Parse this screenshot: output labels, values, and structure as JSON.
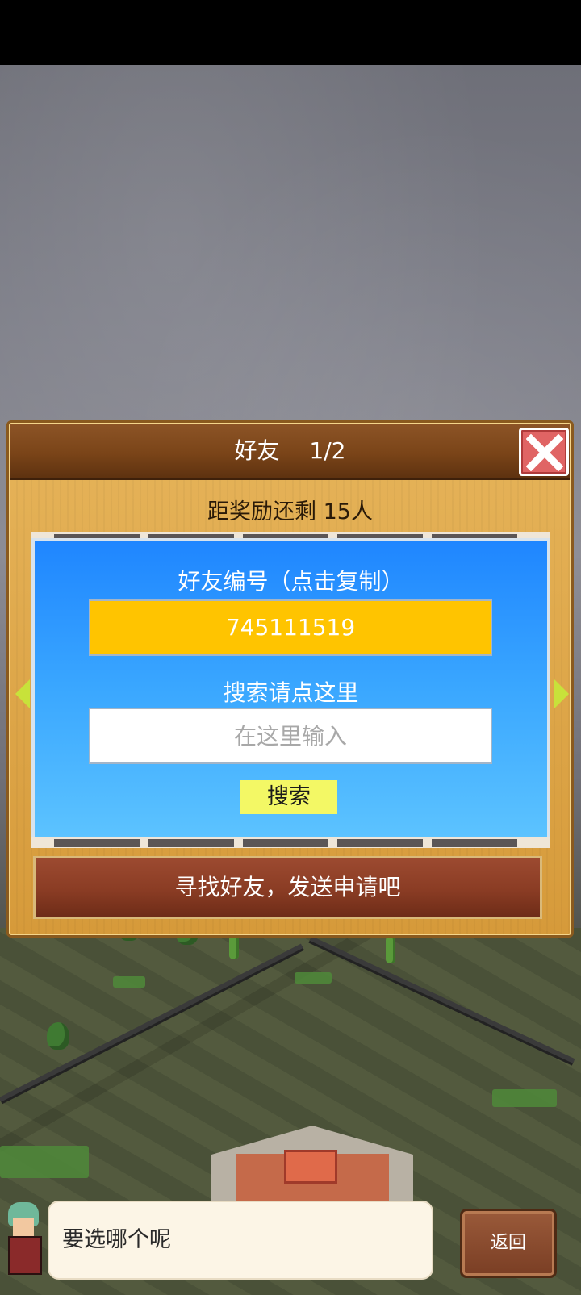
{
  "dialog": {
    "title": "好友　 1/2",
    "reward_text": "距奖励还剩 15人",
    "friend_id_label": "好友编号（点击复制）",
    "friend_id": "745111519",
    "search_label": "搜索请点这里",
    "search_placeholder": "在这里输入",
    "search_button": "搜索",
    "find_friends_button": "寻找好友，发送申请吧"
  },
  "bottom_bar": {
    "speech_text": "要选哪个呢",
    "back_button": "返回"
  },
  "colors": {
    "panel_blue": "#1f86ff",
    "id_box_yellow": "#ffc400",
    "search_button_yellow": "#f3f865",
    "close_red": "#e06464",
    "header_brown": "#7a4418"
  },
  "icons": {
    "close": "close-icon",
    "prev": "arrow-left-icon",
    "next": "arrow-right-icon"
  }
}
